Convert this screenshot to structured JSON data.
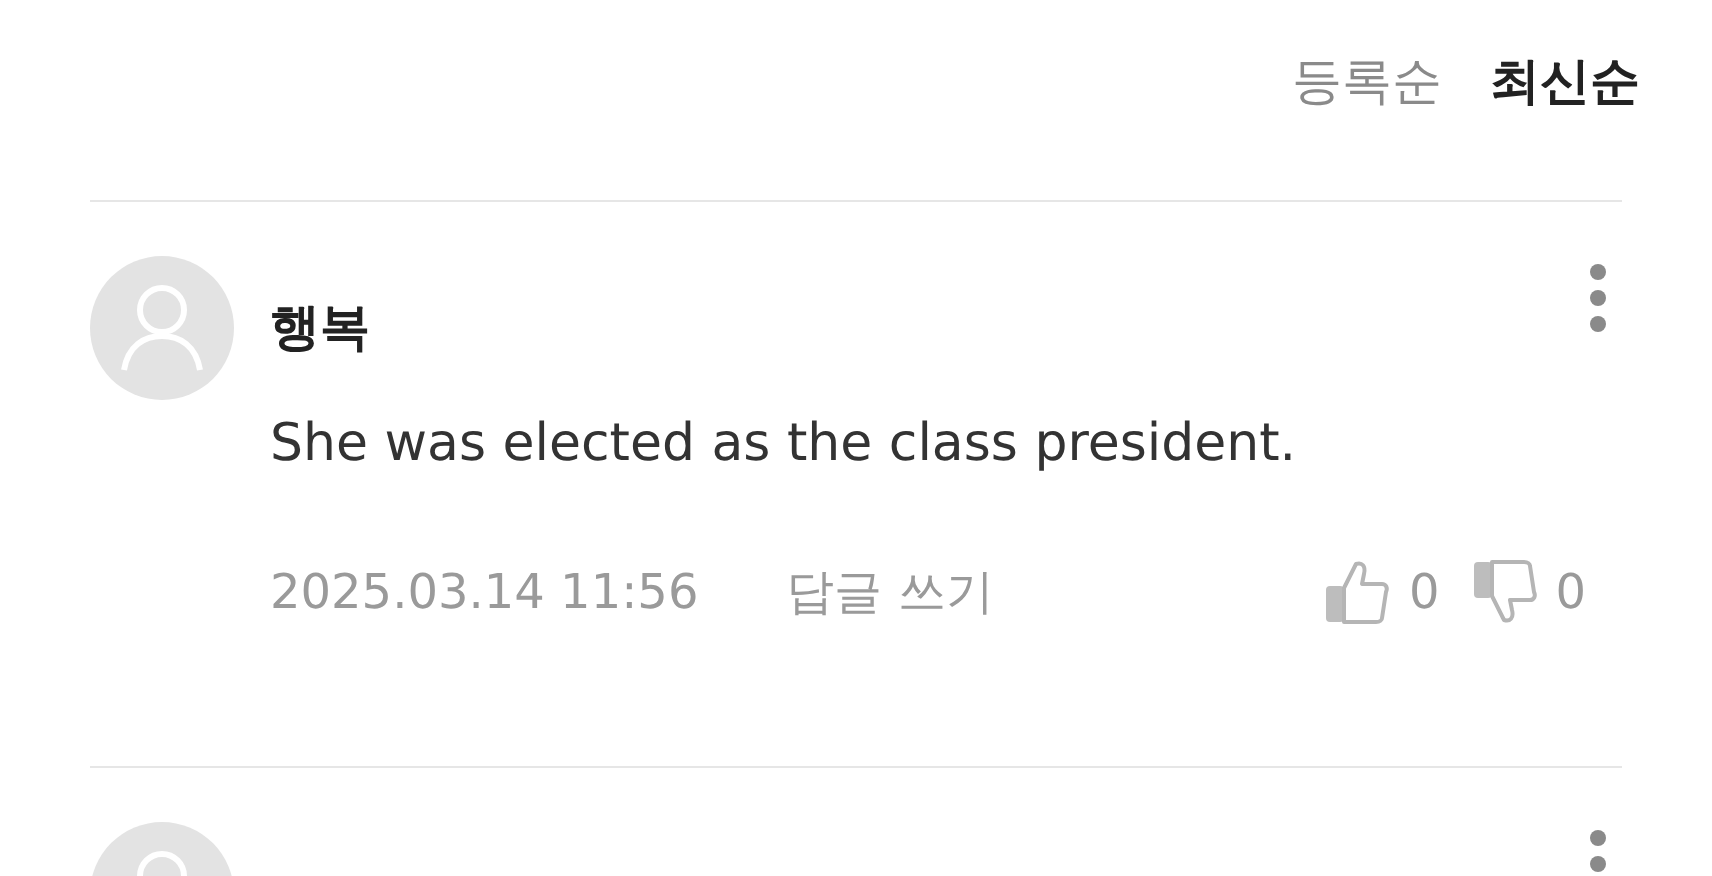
{
  "sort_tabs": [
    {
      "label": "등록순",
      "selected": false
    },
    {
      "label": "최신순",
      "selected": true
    }
  ],
  "comments": [
    {
      "kind": "full",
      "author": "행복",
      "body": "She was elected as the class president.",
      "date": "2025.03.14 11:56",
      "reply": "답글 쓰기",
      "likes": "0",
      "dislikes": "0"
    },
    {
      "kind": "cut_off"
    }
  ]
}
